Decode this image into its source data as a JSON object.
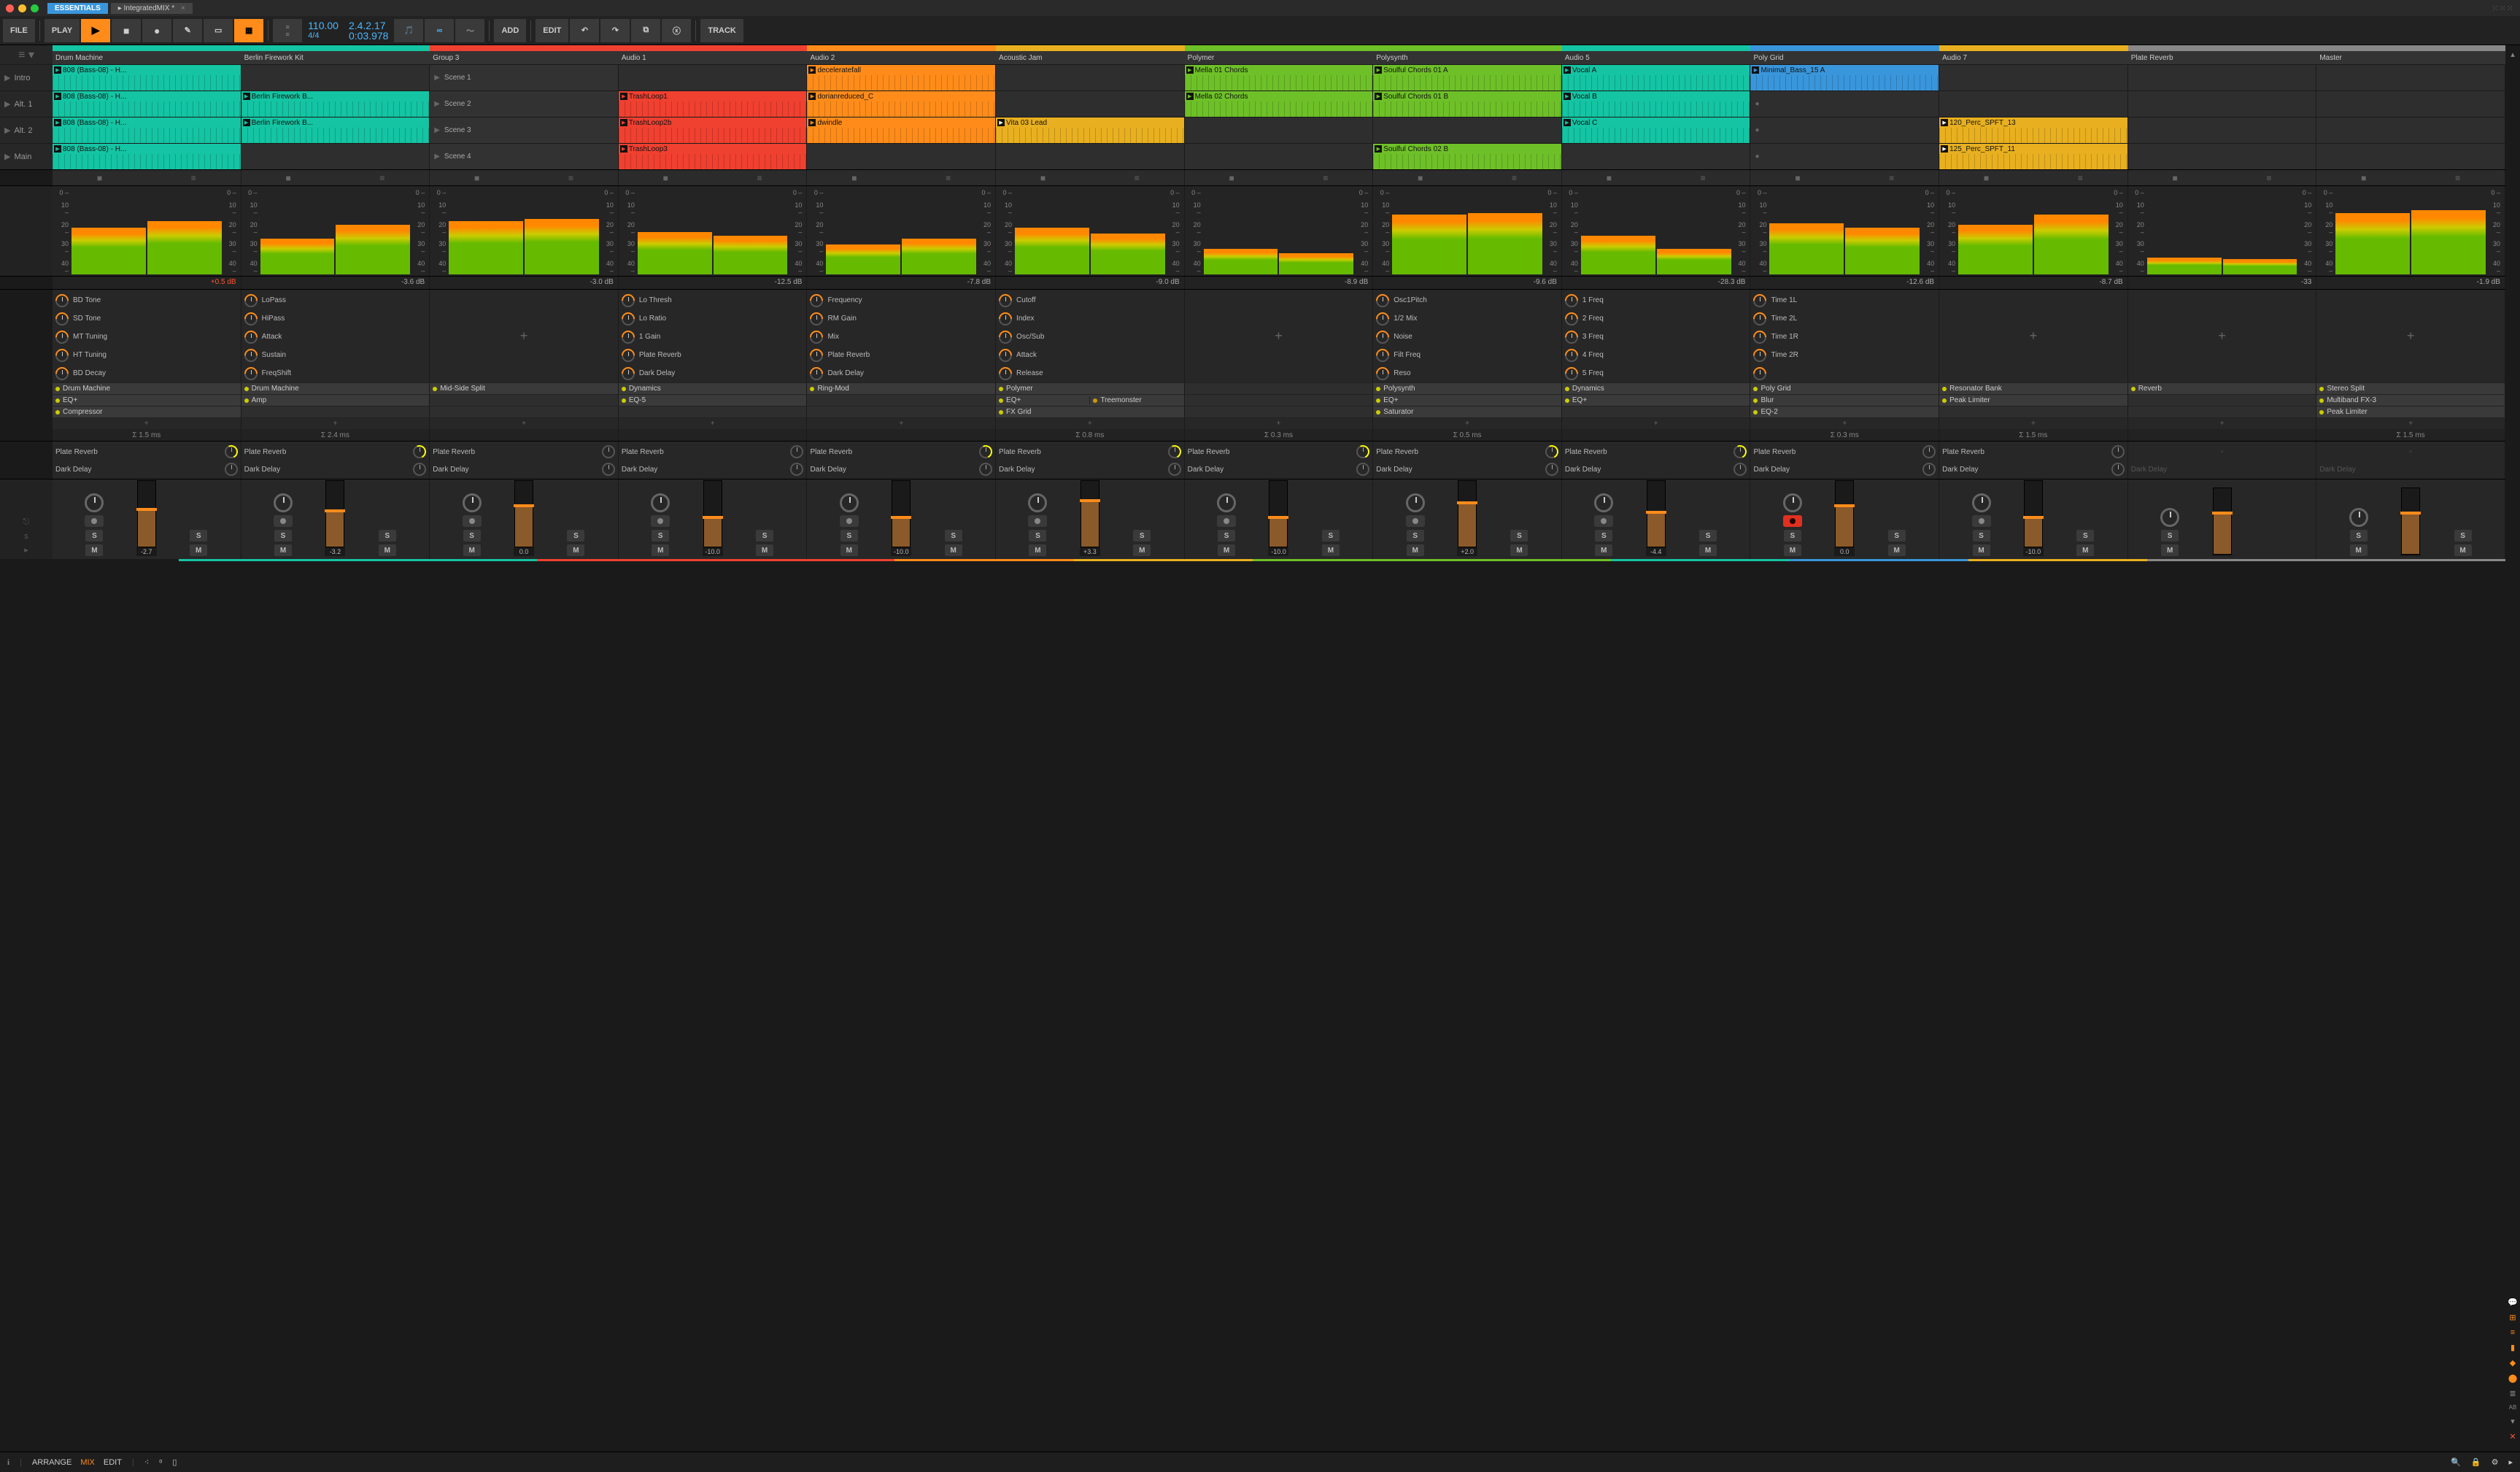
{
  "titlebar": {
    "essentials": "ESSENTIALS",
    "project": "IntegratedMIX *",
    "close": "×"
  },
  "toolbar": {
    "file": "FILE",
    "play": "PLAY",
    "add": "ADD",
    "edit": "EDIT",
    "track": "TRACK",
    "tempo": "110.00",
    "sig": "4/4",
    "pos": "2.4.2.17",
    "time": "0:03.978"
  },
  "scenes": [
    "Intro",
    "Alt. 1",
    "Alt. 2",
    "Main"
  ],
  "sceneClips": [
    "Scene 1",
    "Scene 2",
    "Scene 3",
    "Scene 4"
  ],
  "tracks": [
    {
      "name": "Drum Machine",
      "color": "#14c4a3",
      "db": "+0.5 dB",
      "dbRed": true,
      "fval": "-2.7",
      "clips": [
        "808 (Bass-08) - H...",
        "808 (Bass-08) - H...",
        "808 (Bass-08) - H...",
        "808 (Bass-08) - H..."
      ],
      "clipColor": "#14c4a3",
      "knobs": [
        "BD Tone",
        "SD Tone",
        "MT Tuning",
        "HT Tuning",
        "BD Decay"
      ],
      "devs": [
        "Drum Machine",
        "EQ+",
        "Compressor"
      ],
      "sigma": "Σ 1.5 ms",
      "meter": [
        55,
        62
      ],
      "fader": 55
    },
    {
      "name": "Berlin Firework Kit",
      "color": "#14c4a3",
      "db": "-3.6 dB",
      "fval": "-3.2",
      "clips": [
        "",
        "Berlin Firework B...",
        "Berlin Firework B...",
        ""
      ],
      "clipColor": "#14c4a3",
      "knobs": [
        "LoPass",
        "HiPass",
        "Attack",
        "Sustain",
        "FreqShift"
      ],
      "devs": [
        "Drum Machine",
        "Amp"
      ],
      "sigma": "Σ 2.4 ms",
      "meter": [
        42,
        58
      ],
      "fader": 52
    },
    {
      "name": "Group 3",
      "color": "#f04030",
      "db": "-3.0 dB",
      "fval": "0.0",
      "isGroup": true,
      "clips": [
        "",
        "",
        "",
        ""
      ],
      "devs": [
        "Mid-Side Split"
      ],
      "sigma": "",
      "meter": [
        62,
        65
      ],
      "fader": 60,
      "noKnobs": true
    },
    {
      "name": "Audio 1",
      "color": "#f04030",
      "db": "-12.5 dB",
      "fval": "-10.0",
      "clips": [
        "",
        "TrashLoop1",
        "TrashLoop2b",
        "TrashLoop3"
      ],
      "clipColor": "#f04030",
      "knobs": [
        "Lo Thresh",
        "Lo Ratio",
        "1 Gain",
        "Plate Reverb",
        "Dark Delay"
      ],
      "devs": [
        "Dynamics",
        "EQ-5"
      ],
      "sigma": "",
      "meter": [
        50,
        45
      ],
      "fader": 42
    },
    {
      "name": "Audio 2",
      "color": "#ff8c1a",
      "db": "-7.8 dB",
      "fval": "-10.0",
      "clips": [
        "deceleratefall",
        "dorianreduced_C",
        "dwindle",
        ""
      ],
      "clipColor": "#ff8c1a",
      "knobs": [
        "Frequency",
        "RM Gain",
        "Mix",
        "Plate Reverb",
        "Dark Delay"
      ],
      "devs": [
        "Ring-Mod"
      ],
      "sigma": "",
      "meter": [
        35,
        42
      ],
      "fader": 42
    },
    {
      "name": "Acoustic Jam",
      "color": "#e8b020",
      "db": "-9.0 dB",
      "fval": "+3.3",
      "clips": [
        "",
        "",
        "Vita 03 Lead",
        ""
      ],
      "clipColor": "#e8b020",
      "clipPB": true,
      "knobs": [
        "Cutoff",
        "Index",
        "Osc/Sub",
        "Attack",
        "Release"
      ],
      "devs": [
        "Polymer",
        "EQ+",
        "FX Grid"
      ],
      "sigma": "Σ 0.8 ms",
      "meter": [
        55,
        48
      ],
      "fader": 68,
      "halfDev": [
        "Polymer",
        "Treemonster"
      ]
    },
    {
      "name": "Polymer",
      "color": "#6ec028",
      "db": "-8.9 dB",
      "fval": "-10.0",
      "clips": [
        "Mella 01 Chords",
        "Mella 02 Chords",
        "",
        ""
      ],
      "clipColor": "#6ec028",
      "noKnobs": true,
      "devs": [],
      "sigma": "Σ 0.3 ms",
      "meter": [
        30,
        25
      ],
      "fader": 42
    },
    {
      "name": "Polysynth",
      "color": "#6ec028",
      "db": "-9.6 dB",
      "fval": "+2.0",
      "clips": [
        "Soulful Chords 01 A",
        "Soulful Chords 01 B",
        "",
        "Soulful Chords 02 B"
      ],
      "clipColor": "#6ec028",
      "knobs": [
        "Osc1Pitch",
        "1/2 Mix",
        "Noise",
        "Filt Freq",
        "Reso"
      ],
      "devs": [
        "Polysynth",
        "EQ+",
        "Saturator"
      ],
      "sigma": "Σ 0.5 ms",
      "meter": [
        70,
        72
      ],
      "fader": 65
    },
    {
      "name": "Audio 5",
      "color": "#14c4a3",
      "db": "-28.3 dB",
      "fval": "-4.4",
      "clips": [
        "Vocal A",
        "Vocal B",
        "Vocal C",
        ""
      ],
      "clipColor": "#14c4a3",
      "knobs": [
        "1 Freq",
        "2 Freq",
        "3 Freq",
        "4 Freq",
        "5 Freq"
      ],
      "devs": [
        "Dynamics",
        "EQ+"
      ],
      "sigma": "",
      "meter": [
        45,
        30
      ],
      "fader": 50
    },
    {
      "name": "Poly Grid",
      "color": "#3a96db",
      "db": "-12.6 dB",
      "fval": "0.0",
      "clips": [
        "Minimal_Bass_15 A",
        "",
        "",
        ""
      ],
      "clipColor": "#3a96db",
      "dots": true,
      "knobs": [
        "Time 1L",
        "Time 2L",
        "Time 1R",
        "Time 2R",
        ""
      ],
      "devs": [
        "Poly Grid",
        "Blur",
        "EQ-2"
      ],
      "sigma": "Σ 0.3 ms",
      "meter": [
        60,
        55
      ],
      "fader": 60,
      "armed": true
    },
    {
      "name": "Audio 7",
      "color": "#e8b020",
      "db": "-8.7 dB",
      "fval": "-10.0",
      "clips": [
        "",
        "",
        "120_Perc_SPFT_13",
        "125_Perc_SPFT_11"
      ],
      "clipColor": "#e8b020",
      "clipPB": true,
      "noKnobs": true,
      "devs": [
        "Resonator Bank",
        "Peak Limiter"
      ],
      "sigma": "Σ 1.5 ms",
      "meter": [
        58,
        70
      ],
      "fader": 42
    },
    {
      "name": "Plate Reverb",
      "color": "#888",
      "db": "-33",
      "fval": "",
      "noKnobs": true,
      "narrow": true,
      "clips": [
        "",
        "",
        "",
        ""
      ],
      "devs": [
        "Reverb"
      ],
      "sigma": "",
      "meter": [
        20,
        18
      ],
      "fader": 60,
      "noSends": true
    },
    {
      "name": "Master",
      "color": "#888",
      "db": "-1.9 dB",
      "fval": "",
      "noKnobs": true,
      "clips": [
        "",
        "",
        "",
        ""
      ],
      "devs": [
        "Stereo Split",
        "Multiband FX-3",
        "Peak Limiter"
      ],
      "sigma": "Σ 1.5 ms",
      "meter": [
        72,
        75
      ],
      "fader": 60,
      "noSends": true,
      "isMaster": true
    }
  ],
  "meterScale": [
    "0 –",
    "10 –",
    "20 –",
    "30 –",
    "40 –"
  ],
  "sends": [
    "Plate Reverb",
    "Dark Delay"
  ],
  "bottom": {
    "arrange": "ARRANGE",
    "mix": "MIX",
    "edit": "EDIT"
  },
  "smLabels": {
    "s": "S",
    "m": "M"
  },
  "plus": "+",
  "rec_tooltip": "●"
}
